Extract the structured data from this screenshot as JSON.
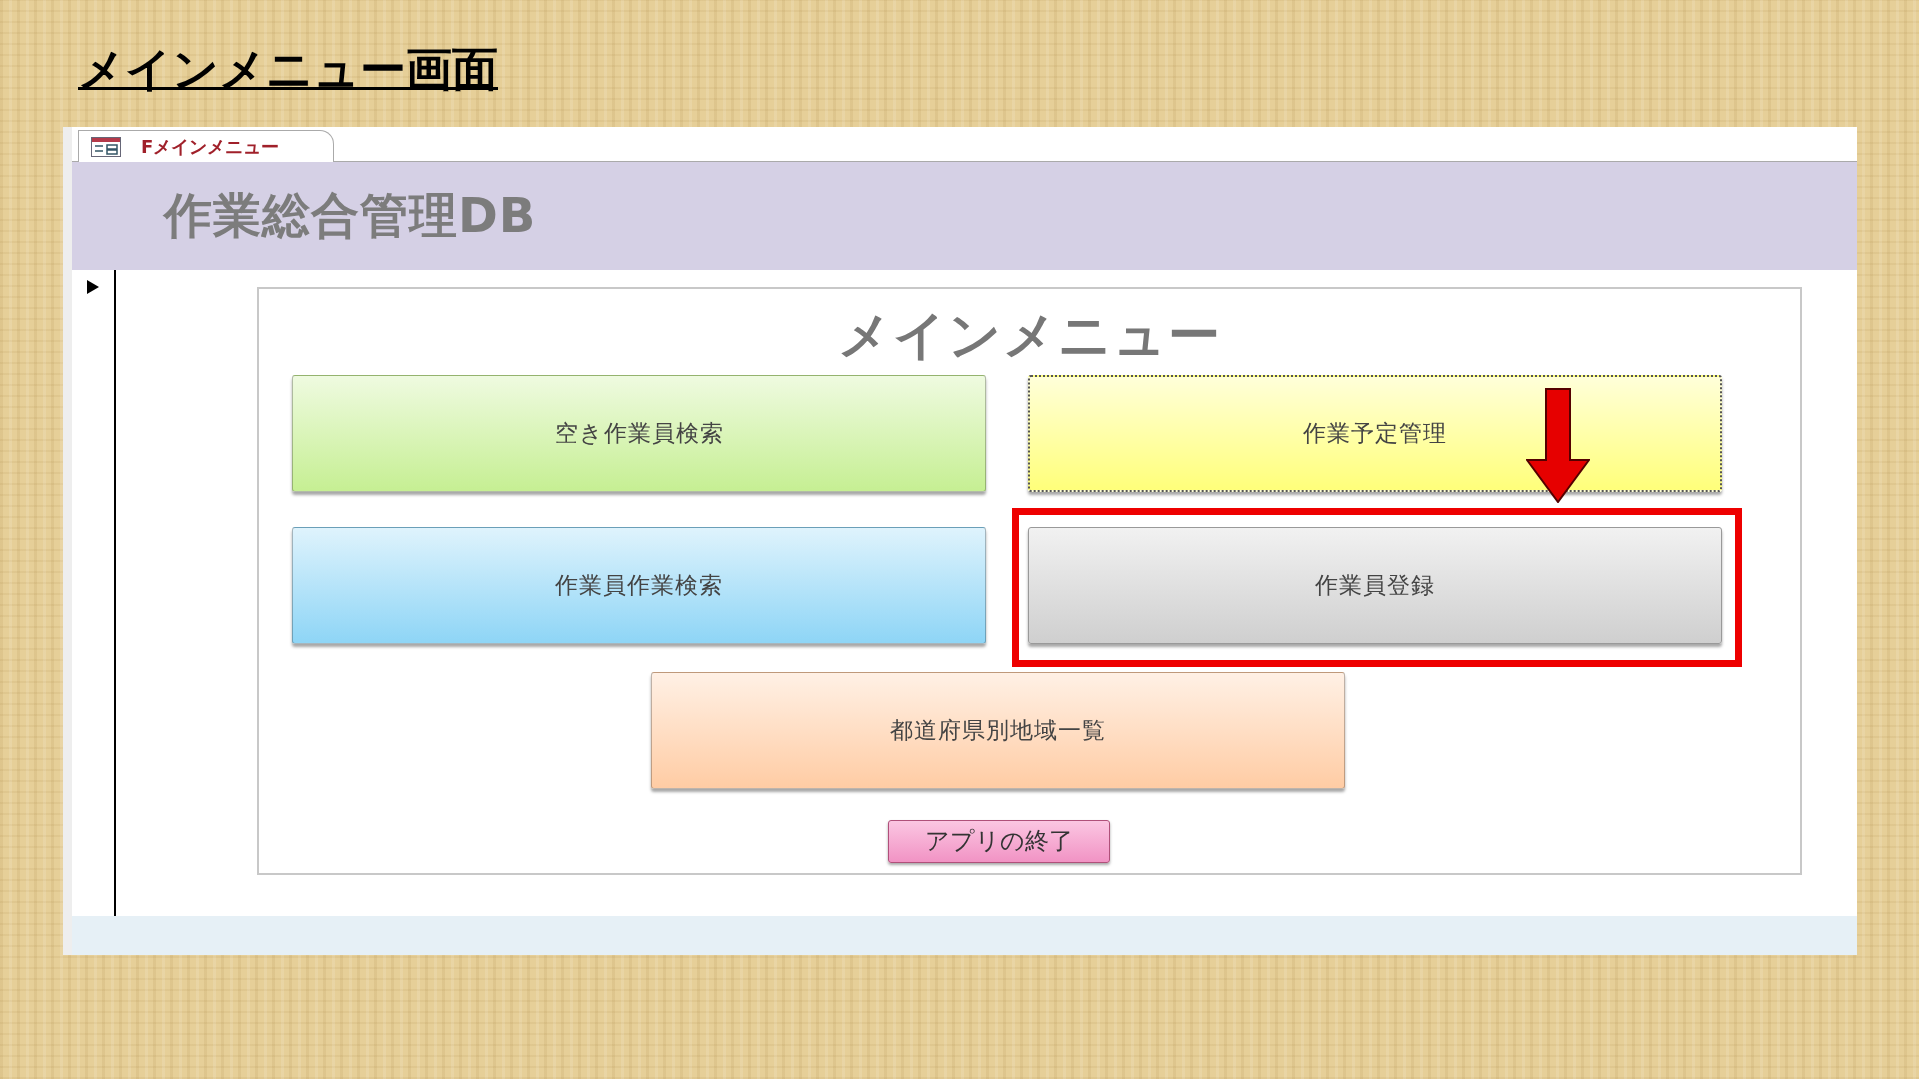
{
  "slide_title": "メインメニュー画面",
  "window": {
    "tab": "Fメインメニュー",
    "header": "作業総合管理DB"
  },
  "menu": {
    "heading": "メインメニュー",
    "buttons": [
      {
        "label": "空き作業員検索",
        "color": "#c6ef93",
        "focused": false,
        "highlighted": false
      },
      {
        "label": "作業予定管理",
        "color": "#ffff7a",
        "focused": true,
        "highlighted": false
      },
      {
        "label": "作業員作業検索",
        "color": "#8ed5f6",
        "focused": false,
        "highlighted": false
      },
      {
        "label": "作業員登録",
        "color": "#cfcfcf",
        "focused": false,
        "highlighted": true
      },
      {
        "label": "都道府県別地域一覧",
        "color": "#ffcca4",
        "focused": false,
        "highlighted": false
      }
    ],
    "exit_button": "アプリの終了"
  }
}
